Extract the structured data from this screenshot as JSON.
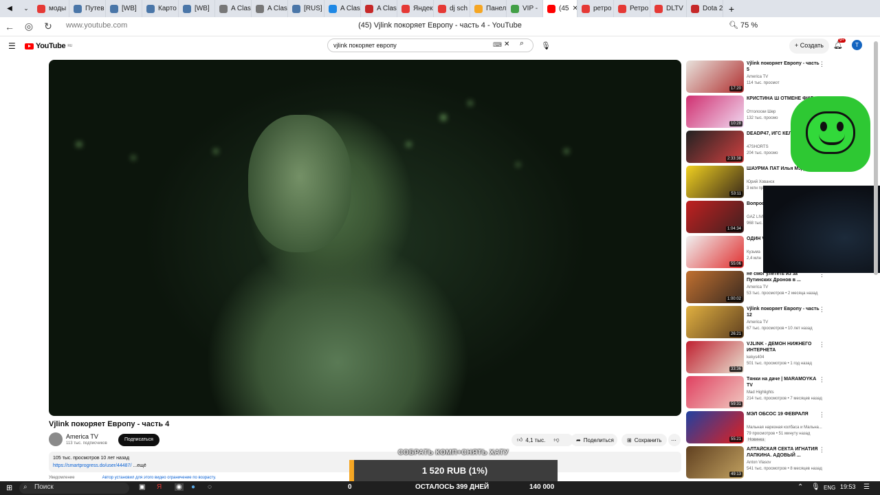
{
  "browser": {
    "tabs": [
      {
        "label": "моды",
        "color": "#e53935"
      },
      {
        "label": "Путев",
        "color": "#4a76a8"
      },
      {
        "label": "[WB]",
        "color": "#4a76a8"
      },
      {
        "label": "Карто",
        "color": "#4a76a8"
      },
      {
        "label": "[WB]",
        "color": "#4a76a8"
      },
      {
        "label": "A Clas",
        "color": "#777777"
      },
      {
        "label": "A Clas",
        "color": "#777777"
      },
      {
        "label": "[RUS]",
        "color": "#4a76a8"
      },
      {
        "label": "A Clas",
        "color": "#1e88e5"
      },
      {
        "label": "A Clas",
        "color": "#c62828"
      },
      {
        "label": "Яндек",
        "color": "#e53935"
      },
      {
        "label": "dj sch",
        "color": "#e53935"
      },
      {
        "label": "Панел",
        "color": "#f5a623"
      },
      {
        "label": "VIP - ",
        "color": "#43a047"
      },
      {
        "label": "(45",
        "color": "#ff0000"
      },
      {
        "label": "ретро",
        "color": "#e53935"
      },
      {
        "label": "Ретро",
        "color": "#e53935"
      },
      {
        "label": "DLTV",
        "color": "#e53935"
      },
      {
        "label": "Dota 2",
        "color": "#c62828"
      }
    ],
    "url": "www.youtube.com",
    "page_title": "(45) Vjlink покоряет Европу - часть 4 - YouTube",
    "zoom": "75 %"
  },
  "youtube": {
    "logo": "YouTube",
    "logo_region": "RU",
    "search_value": "vjlink покоряет европу",
    "create_label": "Создать",
    "notif_count": "9+",
    "avatar_letter": "T"
  },
  "video": {
    "title": "Vjlink покоряет Европу - часть 4",
    "channel": "America TV",
    "subscribers": "113 тыс. подписчиков",
    "subscribe_label": "Подписаться",
    "likes": "4,1 тыс.",
    "share_label": "Поделиться",
    "save_label": "Сохранить",
    "views_date": "105 тыс. просмотров  10 лет назад",
    "link": "https://smartprogress.do/user/44487/",
    "more": "...ещё",
    "notice_label": "Уведомление",
    "notice_text": "Автор установил для этого видео ограничение по возрасту."
  },
  "recommended": [
    {
      "title": "Vjlink покоряет Европу - часть 5",
      "channel": "America TV",
      "meta": "114 тыс. просмот",
      "duration": "17:20",
      "colors": [
        "#e8e2dc",
        "#b03030"
      ]
    },
    {
      "title": "КРИСТИНА Ш ОТМЕНЕ ФИЛ",
      "channel": "Отголоски Шер",
      "meta": "132 тыс. просмо",
      "duration": "10:28",
      "colors": [
        "#d03070",
        "#f0d8f0"
      ]
    },
    {
      "title": "DEADP47, ИГС КЕЛЬ смотря",
      "channel": "47SHORTS",
      "meta": "204 тыс. просмо",
      "duration": "2:33:38",
      "colors": [
        "#222222",
        "#d04040"
      ]
    },
    {
      "title": "ШАУРМА ПАТ Илья Мэддис",
      "channel": "Юрий Хованск",
      "meta": "3 млн просмотр",
      "duration": "53:11",
      "colors": [
        "#f0d020",
        "#3a2a1a"
      ]
    },
    {
      "title": "Вопрос",
      "channel": "GAZ LIVE",
      "meta": "968 тыс.",
      "duration": "1:04:34",
      "colors": [
        "#c02020",
        "#402020"
      ]
    },
    {
      "title": "ОДИН VJLINK",
      "channel": "Кузьма",
      "meta": "2,4 млн",
      "duration": "55:06",
      "colors": [
        "#f0f0f0",
        "#e03030"
      ]
    },
    {
      "title": "не смог улететь из за Путинских Дронов в ...",
      "channel": "America TV",
      "meta": "53 тыс. просмотров • 2 месяца назад",
      "duration": "1:00:02",
      "colors": [
        "#c07030",
        "#3a2a20"
      ]
    },
    {
      "title": "Vjlink покоряет Европу - часть 12",
      "channel": "America TV",
      "meta": "67 тыс. просмотров • 10 лет назад",
      "duration": "26:21",
      "colors": [
        "#e0b040",
        "#604020"
      ]
    },
    {
      "title": "VJLINK - ДЕМОН НИЖНЕГО ИНТЕРНЕТА",
      "channel": "kekys404",
      "meta": "501 тыс. просмотров • 1 год назад",
      "duration": "33:36",
      "colors": [
        "#c02030",
        "#e8e0d0"
      ]
    },
    {
      "title": "Тянки на даче | MARAMOYKA TV",
      "channel": "Mad Highlights",
      "meta": "214 тыс. просмотров • 7 месяцев назад",
      "duration": "59:31",
      "colors": [
        "#e04060",
        "#f0c8c0"
      ]
    },
    {
      "title": "МЭЛ ОБСОС 19 ФЕВРАЛЯ",
      "channel": "Мальная нарезная колбаса и Мальна...",
      "meta": "79 просмотров • 51 минуту назад",
      "duration": "55:21",
      "colors": [
        "#2040a0",
        "#e02020"
      ]
    },
    {
      "title": "АЛТАЙСКАЯ СЕКТА ИГНАТИЯ ЛАПКИНА. АДОВЫЙ ...",
      "channel": "Anton Vlasov",
      "meta": "541 тыс. просмотров • 8 месяцев назад",
      "duration": "49:13",
      "colors": [
        "#604020",
        "#c0a060"
      ]
    }
  ],
  "new_badge": "Новинка",
  "overlay": {
    "donate_label": "СОБРАТЬ КОМП+СНЯТЬ ХАТУ",
    "donate_amount": "1 520 RUB (1%)",
    "goal_start": "0",
    "goal_remaining": "ОСТАЛОСЬ 399 ДНЕЙ",
    "goal_target": "140 000",
    "progress_fraction": 0.01
  },
  "taskbar": {
    "search_label": "Поиск",
    "lang": "ENG",
    "time": "19:53"
  }
}
